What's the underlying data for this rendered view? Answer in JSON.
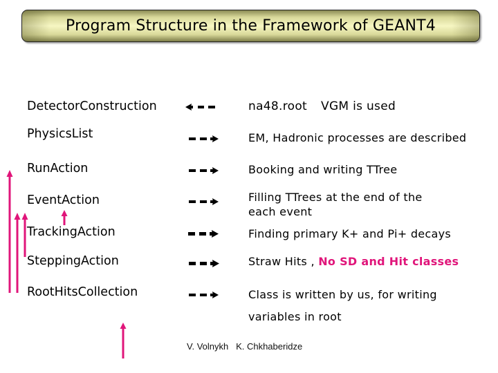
{
  "slide": {
    "title": "Program Structure in the Framework of  GEANT4",
    "rows": [
      {
        "label": "DetectorConstruction",
        "direction": "left",
        "description": "na48.root",
        "description_extra": "VGM is used"
      },
      {
        "label": "PhysicsList",
        "direction": "right",
        "description": "EM, Hadronic processes  are described"
      },
      {
        "label": "RunAction",
        "direction": "right",
        "description": "Booking and writing TTree"
      },
      {
        "label": "EventAction",
        "direction": "right",
        "description": "Filling TTrees at the end of the",
        "description_line2": "each event"
      },
      {
        "label": "TrackingAction",
        "direction": "right",
        "description": "Finding primary K+ and Pi+ decays"
      },
      {
        "label": "SteppingAction",
        "direction": "right",
        "description": "Straw Hits , ",
        "description_highlight": "No SD and Hit classes"
      },
      {
        "label": "RootHitsCollection",
        "direction": "right",
        "description": "Class is written by us, for writing",
        "description_line2": "variables in root"
      }
    ],
    "authors": "V. Volnykh   K. Chkhaberidze"
  },
  "colors": {
    "accent": "#e0157a",
    "text": "#000000",
    "title_bg": "#f6f6c2"
  }
}
